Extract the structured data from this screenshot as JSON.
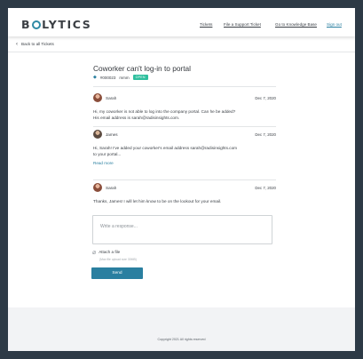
{
  "app": {
    "logo": "BIOLYTICS"
  },
  "nav": {
    "tickets": "Tickets",
    "file_ticket": "File a Support Ticket",
    "knowledge_base": "Go to Knowledge Base",
    "sign_out": "Sign out"
  },
  "back_link": "Back to all Tickets",
  "ticket": {
    "title": "Coworker can't log-in to portal",
    "id": "#000023",
    "category": "mmm",
    "status": "OPEN",
    "status_color": "#2fbf9e"
  },
  "messages": [
    {
      "author": "Sarah",
      "date": "Dec 7, 2020",
      "lines": [
        "Hi,  my coworker is not able to log into the company portal. Can he be added?",
        "His email address is sarah@radisinsights.com."
      ]
    },
    {
      "author": "James",
      "date": "Dec 7, 2020",
      "lines": [
        "Hi, Sarah! I've added your coworker's email address sarah@radisinsights.com",
        "to your portal..."
      ],
      "read_more": "Read more"
    },
    {
      "author": "Sarah",
      "date": "Dec 7, 2020",
      "lines": [
        "Thanks, James! I will let him know to be on the lookout for your email."
      ]
    }
  ],
  "reply": {
    "placeholder": "Write a response...",
    "attach_label": "Attach a file",
    "attach_note": "(Max file upload size 30MB)",
    "send_label": "Send"
  },
  "footer": {
    "copyright": "Copyright 2021 All rights reserved"
  },
  "colors": {
    "accent": "#2a7fa0",
    "frame": "#2d3a46",
    "footer_bg": "#f2f3f5"
  }
}
